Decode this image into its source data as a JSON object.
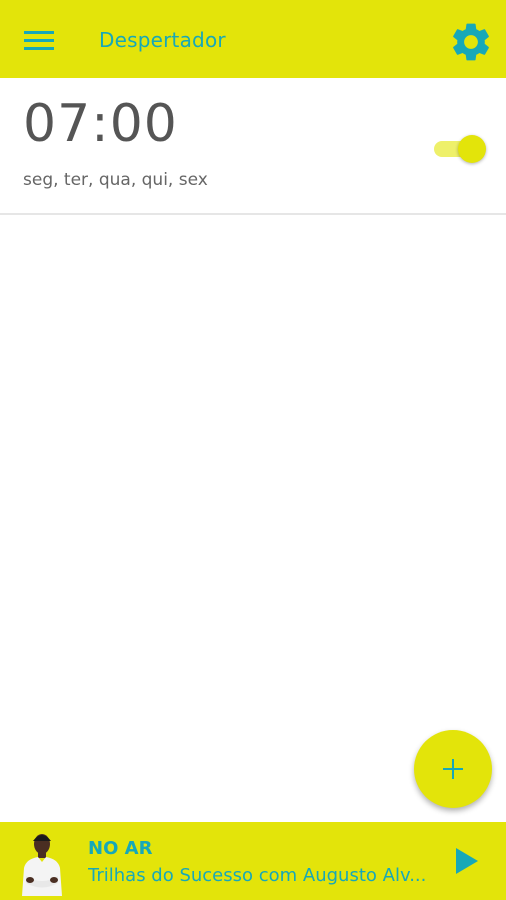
{
  "app": {
    "title": "Despertador",
    "colors": {
      "accent": "#e3e40a",
      "primary_text": "#17a8b8",
      "time_text": "#555555"
    }
  },
  "header": {
    "menu_icon": "hamburger-menu-icon",
    "settings_icon": "gear-icon"
  },
  "alarms": [
    {
      "time": "07:00",
      "days": "seg, ter, qua, qui, sex",
      "enabled": true
    }
  ],
  "fab": {
    "icon": "plus-icon"
  },
  "player": {
    "status": "NO AR",
    "program": "Trilhas do Sucesso com Augusto Alv...",
    "play_icon": "play-icon"
  }
}
